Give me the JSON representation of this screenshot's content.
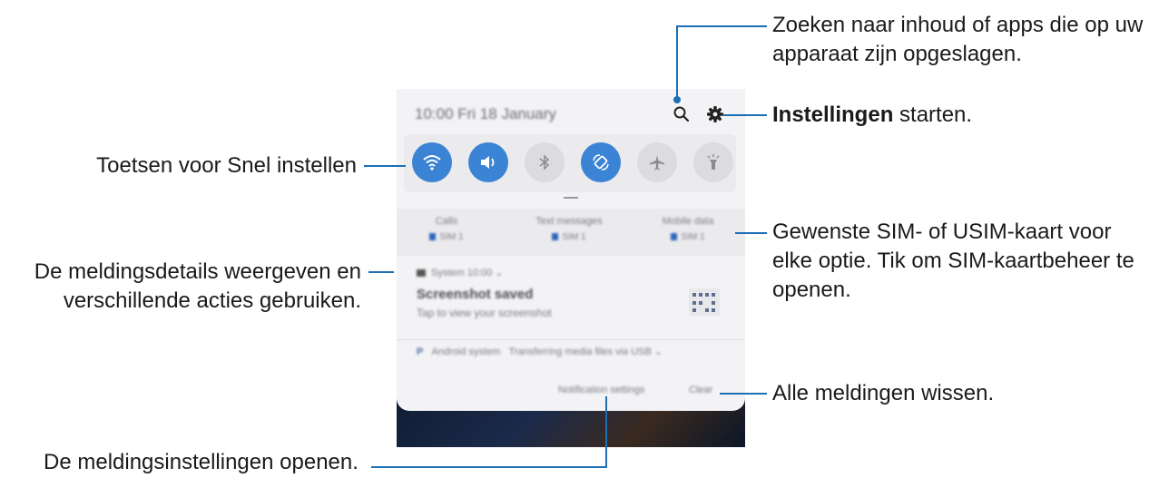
{
  "phone": {
    "status_time": "10:00  Fri 18 January",
    "icons": [
      "search-icon",
      "gear-icon"
    ],
    "quick_settings": [
      {
        "icon": "wifi-icon",
        "state": "on"
      },
      {
        "icon": "sound-icon",
        "state": "on"
      },
      {
        "icon": "bluetooth-icon",
        "state": "off"
      },
      {
        "icon": "auto-rotate-icon",
        "state": "on"
      },
      {
        "icon": "airplane-icon",
        "state": "off"
      },
      {
        "icon": "flashlight-icon",
        "state": "off"
      }
    ],
    "sim_options": [
      {
        "label": "Calls",
        "sim": "SIM 1"
      },
      {
        "label": "Text messages",
        "sim": "SIM 1"
      },
      {
        "label": "Mobile data",
        "sim": "SIM 1"
      }
    ],
    "notification1": {
      "app": "System  10:00",
      "title": "Screenshot saved",
      "subtitle": "Tap to view your screenshot"
    },
    "notification2": {
      "app": "Android system",
      "text": "Transferring media files via USB"
    },
    "notification_settings_label": "Notification settings",
    "clear_label": "Clear"
  },
  "callouts": {
    "search": "Zoeken naar inhoud of apps die op uw apparaat zijn opgeslagen.",
    "settings_bold": "Instellingen",
    "settings_rest": " starten.",
    "quick": "Toetsen voor Snel instellen",
    "sim": "Gewenste SIM- of USIM-kaart voor elke optie. Tik om SIM-kaartbeheer te openen.",
    "details": "De meldingsdetails weergeven en verschillende acties gebruiken.",
    "clear": "Alle meldingen wissen.",
    "notif_settings": "De meldingsinstellingen openen."
  },
  "colors": {
    "accent": "#1a6fb5",
    "toggle_on": "#3b83d4"
  }
}
